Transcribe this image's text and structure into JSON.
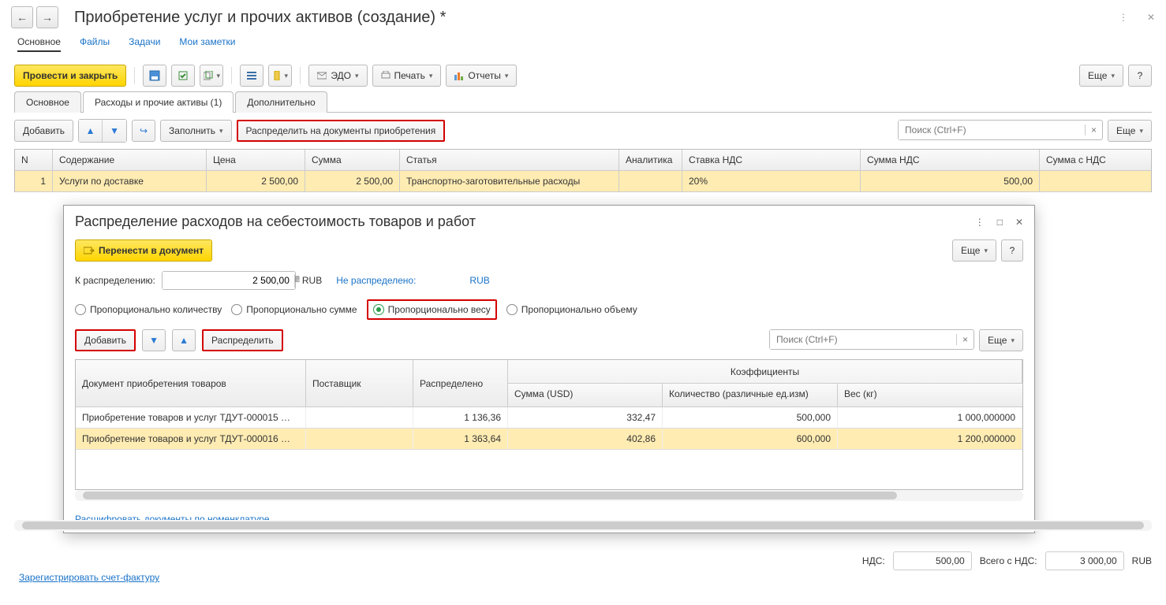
{
  "header": {
    "title": "Приобретение услуг и прочих активов (создание) *"
  },
  "nav": {
    "main": "Основное",
    "files": "Файлы",
    "tasks": "Задачи",
    "notes": "Мои заметки"
  },
  "toolbar": {
    "post_close": "Провести и закрыть",
    "edo": "ЭДО",
    "print": "Печать",
    "reports": "Отчеты",
    "more": "Еще",
    "help": "?"
  },
  "tabs": {
    "t1": "Основное",
    "t2": "Расходы и прочие активы (1)",
    "t3": "Дополнительно"
  },
  "subbar": {
    "add": "Добавить",
    "fill": "Заполнить",
    "distribute_docs": "Распределить на документы приобретения",
    "search_ph": "Поиск (Ctrl+F)",
    "more": "Еще"
  },
  "grid": {
    "cols": {
      "n": "N",
      "content": "Содержание",
      "price": "Цена",
      "sum": "Сумма",
      "article": "Статья",
      "analytics": "Аналитика",
      "vat_rate": "Ставка НДС",
      "vat_sum": "Сумма НДС",
      "sum_vat": "Сумма с НДС"
    },
    "rows": [
      {
        "n": "1",
        "content": "Услуги по доставке",
        "price": "2 500,00",
        "sum": "2 500,00",
        "article": "Транспортно-заготовительные расходы",
        "analytics": "",
        "vat_rate": "20%",
        "vat_sum": "500,00",
        "sum_vat": ""
      }
    ]
  },
  "dialog": {
    "title": "Распределение расходов на себестоимость товаров и работ",
    "transfer": "Перенести в документ",
    "more": "Еще",
    "help": "?",
    "to_distribute_lbl": "К распределению:",
    "to_distribute_val": "2 500,00",
    "cur1": "RUB",
    "not_distributed_lbl": "Не распределено:",
    "cur2": "RUB",
    "radios": {
      "qty": "Пропорционально количеству",
      "sum": "Пропорционально сумме",
      "weight": "Пропорционально весу",
      "vol": "Пропорционально объему"
    },
    "tbar": {
      "add": "Добавить",
      "dist": "Распределить",
      "search_ph": "Поиск (Ctrl+F)",
      "more": "Еще"
    },
    "cols": {
      "doc": "Документ приобретения товаров",
      "supplier": "Поставщик",
      "distributed": "Распределено",
      "coef": "Коэффициенты",
      "sum": "Сумма (USD)",
      "qty": "Количество (различные ед.изм)",
      "weight": "Вес (кг)"
    },
    "rows": [
      {
        "doc": "Приобретение товаров и услуг ТДУТ-000015 …",
        "supplier": "",
        "distributed": "1 136,36",
        "sum": "332,47",
        "qty": "500,000",
        "weight": "1 000,000000"
      },
      {
        "doc": "Приобретение товаров и услуг ТДУТ-000016 …",
        "supplier": "",
        "distributed": "1 363,64",
        "sum": "402,86",
        "qty": "600,000",
        "weight": "1 200,000000"
      }
    ],
    "decode_link": "Расшифровать документы по номенклатуре"
  },
  "totals": {
    "vat_lbl": "НДС:",
    "vat": "500,00",
    "total_lbl": "Всего с НДС:",
    "total": "3 000,00",
    "cur": "RUB"
  },
  "footer": {
    "reg": "Зарегистрировать счет-фактуру"
  }
}
